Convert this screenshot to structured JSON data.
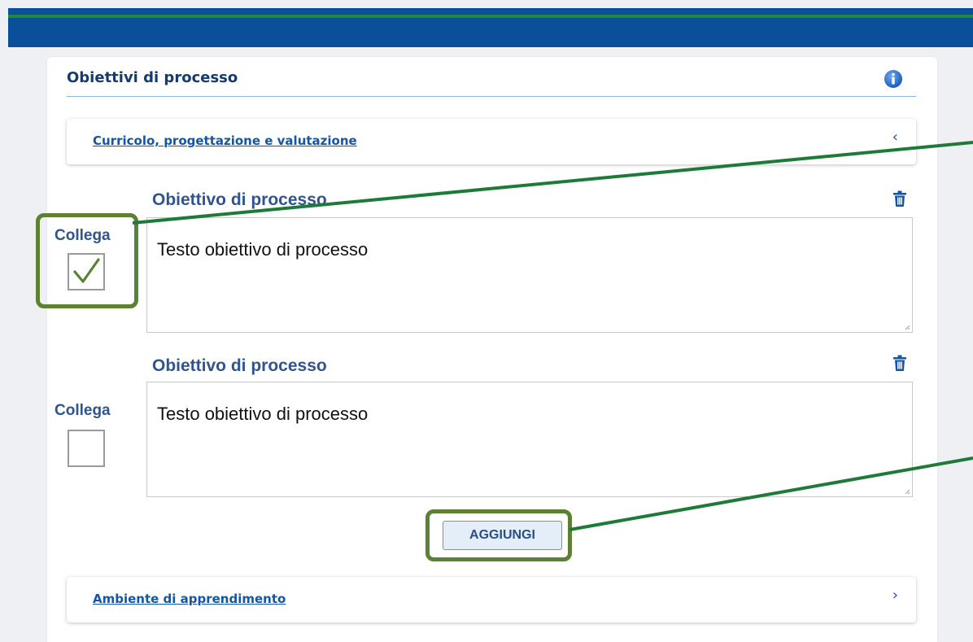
{
  "colors": {
    "header_blue": "#0b4e9a",
    "header_green_stripe": "#1f8c3c",
    "title_color": "#153a6b",
    "link_color": "#1455a4",
    "heading_color": "#30558e",
    "highlight_green": "#5a8232",
    "callout_line": "#1f7a3a"
  },
  "section": {
    "title": "Obiettivi di processo",
    "info_icon": "info-icon"
  },
  "accordions": [
    {
      "label": "Curricolo, progettazione e valutazione",
      "chevron": "‹",
      "expanded": true
    },
    {
      "label": "Ambiente di apprendimento",
      "chevron": "›",
      "expanded": false
    }
  ],
  "objectives": [
    {
      "heading": "Obiettivo di processo",
      "text": "Testo obiettivo di processo",
      "link_label": "Collega",
      "checked": true,
      "delete_icon": "trash-icon"
    },
    {
      "heading": "Obiettivo di processo",
      "text": "Testo obiettivo di processo",
      "link_label": "Collega",
      "checked": false,
      "delete_icon": "trash-icon"
    }
  ],
  "add_button": {
    "label": "AGGIUNGI"
  }
}
